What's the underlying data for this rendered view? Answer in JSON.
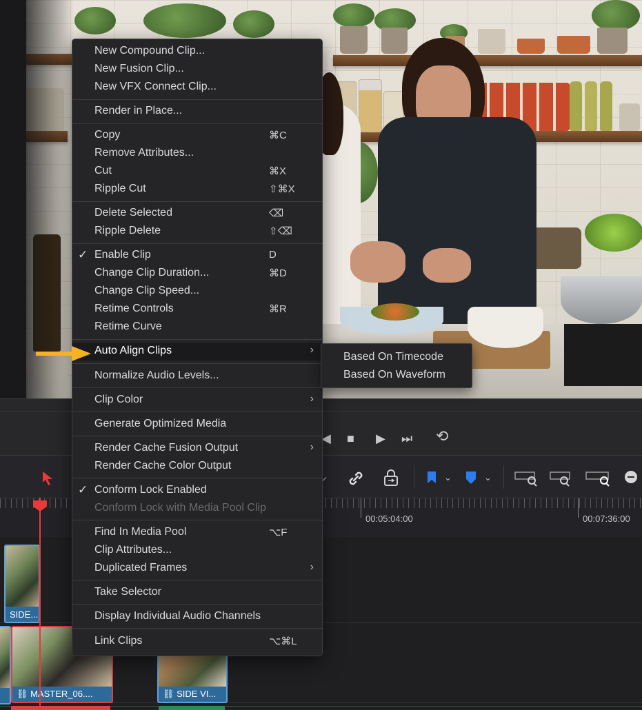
{
  "context_menu": {
    "items": [
      {
        "label": "New Compound Clip..."
      },
      {
        "label": "New Fusion Clip..."
      },
      {
        "label": "New VFX Connect Clip..."
      },
      {
        "label": "Render in Place..."
      },
      {
        "label": "Copy",
        "shortcut": "⌘C"
      },
      {
        "label": "Remove Attributes..."
      },
      {
        "label": "Cut",
        "shortcut": "⌘X"
      },
      {
        "label": "Ripple Cut",
        "shortcut": "⇧⌘X"
      },
      {
        "label": "Delete Selected",
        "shortcut": "⌫"
      },
      {
        "label": "Ripple Delete",
        "shortcut": "⇧⌫"
      },
      {
        "label": "Enable Clip",
        "shortcut": "D",
        "checked": true
      },
      {
        "label": "Change Clip Duration...",
        "shortcut": "⌘D"
      },
      {
        "label": "Change Clip Speed..."
      },
      {
        "label": "Retime Controls",
        "shortcut": "⌘R"
      },
      {
        "label": "Retime Curve"
      },
      {
        "label": "Auto Align Clips",
        "submenu": true,
        "highlighted": true
      },
      {
        "label": "Normalize Audio Levels..."
      },
      {
        "label": "Clip Color",
        "submenu": true
      },
      {
        "label": "Generate Optimized Media"
      },
      {
        "label": "Render Cache Fusion Output",
        "submenu": true
      },
      {
        "label": "Render Cache Color Output"
      },
      {
        "label": "Conform Lock Enabled",
        "checked": true
      },
      {
        "label": "Conform Lock with Media Pool Clip",
        "disabled": true
      },
      {
        "label": "Find In Media Pool",
        "shortcut": "⌥F"
      },
      {
        "label": "Clip Attributes..."
      },
      {
        "label": "Duplicated Frames",
        "submenu": true
      },
      {
        "label": "Take Selector"
      },
      {
        "label": "Display Individual Audio Channels"
      },
      {
        "label": "Link Clips",
        "shortcut": "⌥⌘L"
      }
    ],
    "check_glyph": "✓",
    "chevron_glyph": "›"
  },
  "submenu": {
    "items": [
      {
        "label": "Based On Timecode"
      },
      {
        "label": "Based On Waveform"
      }
    ]
  },
  "timeline": {
    "timecodes": [
      "00:05:04:00",
      "00:07:36:00"
    ],
    "clips": [
      {
        "label": "SIDE..."
      },
      {
        "label": "MASTER_06...."
      },
      {
        "label": "SIDE VI..."
      }
    ]
  },
  "colors": {
    "accent_arrow": "#f5b324",
    "playhead": "#e83a3a",
    "clip_blue": "#2d6a9c",
    "flag_blue": "#2f7cf0"
  }
}
